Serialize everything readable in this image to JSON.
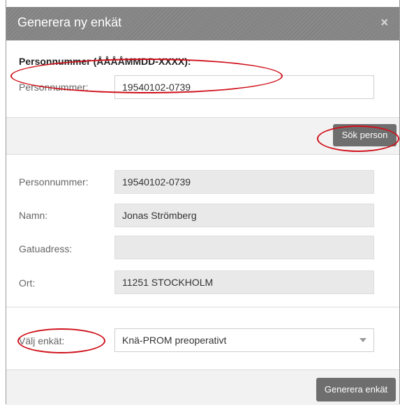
{
  "dialog": {
    "title": "Generera ny enkät",
    "close_glyph": "×",
    "close_icon": "close-icon"
  },
  "search": {
    "heading": "Personnummer (ÅÅÅÅMMDD-XXXX):",
    "label": "Personnummer:",
    "value": "19540102-0739",
    "button": "Sök person"
  },
  "person": {
    "personnummer_label": "Personnummer:",
    "personnummer_value": "19540102-0739",
    "namn_label": "Namn:",
    "namn_value": "Jonas Strömberg",
    "gatuadress_label": "Gatuadress:",
    "gatuadress_value": "",
    "ort_label": "Ort:",
    "ort_value": "11251 STOCKHOLM"
  },
  "survey": {
    "label": "Välj enkät:",
    "selected": "Knä-PROM preoperativt",
    "dropdown_icon": "chevron-down-icon"
  },
  "footer": {
    "button": "Generera enkät"
  },
  "annotation_color": "#d0101a"
}
